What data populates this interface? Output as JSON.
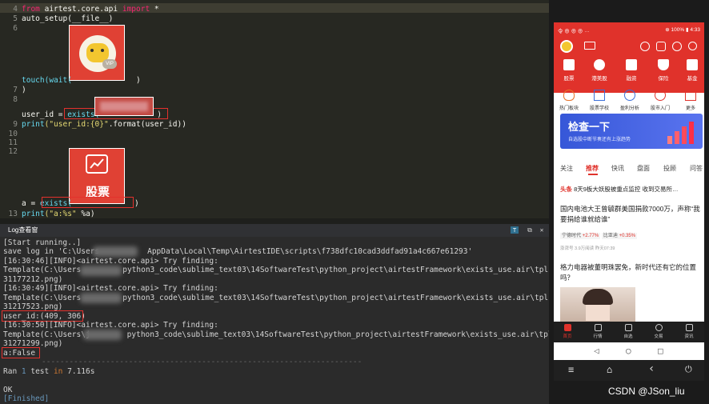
{
  "editor": {
    "line_numbers": [
      "4",
      "5",
      "6",
      "7",
      "8",
      "9",
      "10",
      "11",
      "12",
      "13"
    ],
    "l4_from": "from",
    "l4_module": " airtest.core.api ",
    "l4_import": "import",
    "l4_star": " *",
    "l5": "auto_setup(__file__)",
    "l7_touch": "touch(",
    "l7_wait": "wait(",
    "l7_close": ")",
    "l8_close": ")",
    "l9_var": "user_id = ",
    "l9_exists": "exists(",
    "l9_close": ")",
    "l10_print": "print",
    "l10_str": "(\"user_id:{0}\"",
    "l10_rest": ".format(user_id))",
    "l12_var": "a = ",
    "l12_exists": "exists(",
    "l12_close": ")",
    "l13_print": "print",
    "l13_str": "(\"a:%s\"",
    "l13_rest": " %a)",
    "template_stock_label": "股票",
    "template_vip_label": "VIP"
  },
  "log_panel": {
    "title": "Log查看窗",
    "lines": {
      "l1": "[Start running..]",
      "l2a": "save log in 'C:\\Users",
      "l2b": "AppData\\Local\\Temp\\AirtestIDE\\scripts\\f738dfc10cad3ddfad91a4c667e61293'",
      "l3": "[16:30:46][INFO]<airtest.core.api> Try finding:",
      "l4a": "Template(C:\\Users",
      "l4b": "python3_code\\sublime_text03\\14SoftwareTest\\python_project\\airtestFramework\\exists_use.air\\tpl16543",
      "l5": "31177212.png)",
      "l6": "[16:30:49][INFO]<airtest.core.api> Try finding:",
      "l7a": "Template(C:\\Users",
      "l7b": "python3_code\\sublime_text03\\14SoftwareTest\\python_project\\airtestFramework\\exists_use.air\\tpl16543",
      "l8": "31217523.png)",
      "l9": "user_id:(409, 306)",
      "l10": "[16:30:50][INFO]<airtest.core.api> Try finding:",
      "l11a": "Template(C:\\Users\\j",
      "l11b": "python3_code\\sublime_text03\\14SoftwareTest\\python_project\\airtestFramework\\exists_use.air\\tpl16543",
      "l12": "31271299.png)",
      "l13": "a:False",
      "sep": "----------------------------------------------------------------------",
      "l14a": "Ran ",
      "l14b": "1",
      "l14c": " test ",
      "l14d": "in",
      "l14e": " 7.116s",
      "l15": "OK",
      "l16": "[Finished]"
    }
  },
  "phone": {
    "status_left": "令 ⊕ ⊕ ⊕ ···",
    "status_right": "⊕ 100% ▮ 4:33",
    "tiles": [
      "股票",
      "港美股",
      "融资",
      "保险",
      "基金"
    ],
    "row2": [
      "热门板块",
      "股票学校",
      "盈利分析",
      "股市入门",
      "更多"
    ],
    "banner_title": "检查一下",
    "banner_sub": "自选股中断节奏还有上涨趋势",
    "tabs": [
      "关注",
      "推荐",
      "快讯",
      "盘面",
      "投顾",
      "问答"
    ],
    "headline_tag": "头条",
    "headline": "8天9板大妖股被重点监控 收到交易所…",
    "news1": "国内电池大王曾毓群美国捐款7000万，声称“我要捐给谁就给谁”",
    "quote1_name": "宁德时代",
    "quote1_val": "+2.77%",
    "quote2_name": "比亚迪",
    "quote2_val": "+0.35%",
    "news1_meta": "澎湃号  3.9万阅读  昨天07:39",
    "news2": "格力电器被董明珠罢免，新时代还有它的位置吗？",
    "bottom_nav": [
      "首页",
      "行情",
      "自选",
      "交易",
      "资讯"
    ],
    "sys_nav": [
      "◁",
      "○",
      "□"
    ],
    "ctrl_nav": [
      "≡",
      "⌂",
      "‹",
      "⏻"
    ]
  },
  "watermark": "CSDN @JSon_liu"
}
